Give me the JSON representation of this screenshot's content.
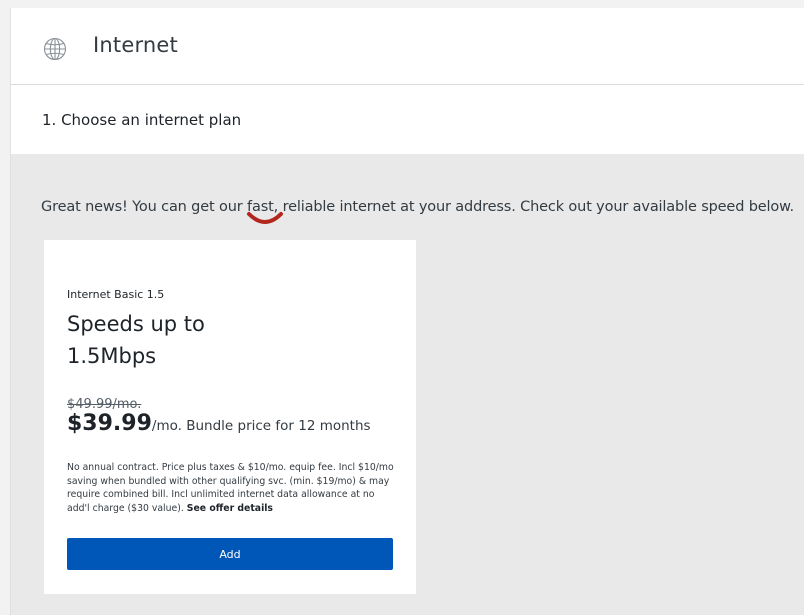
{
  "header": {
    "icon": "globe-icon",
    "title": "Internet"
  },
  "step": {
    "label": "1. Choose an internet plan"
  },
  "availability": {
    "message": "Great news! You can get our fast, reliable internet at your address. Check out your available speed below."
  },
  "plan": {
    "name": "Internet Basic 1.5",
    "speed": "Speeds up to 1.5Mbps",
    "old_price": "$49.99/mo.",
    "price": "$39.99",
    "price_suffix": "/mo. Bundle price for 12 months",
    "fine_print": "No annual contract. Price plus taxes & $10/mo. equip fee. Incl $10/mo saving when bundled with other qualifying svc. (min. $19/mo) & may require combined bill. Incl unlimited internet data allowance at no add'l charge ($30 value). ",
    "offer_details_link": "See offer details",
    "add_button": "Add"
  },
  "colors": {
    "accent": "#0057b8",
    "annotation_mark": "#b3261e"
  }
}
